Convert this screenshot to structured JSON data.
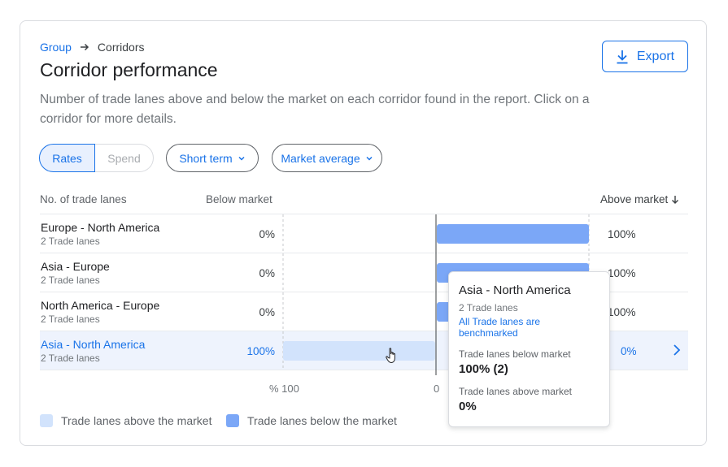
{
  "breadcrumb": {
    "group": "Group",
    "current": "Corridors"
  },
  "page": {
    "title": "Corridor performance",
    "description": "Number of trade lanes above and below the market on each corridor found in the report. Click on a corridor for more details."
  },
  "toolbar": {
    "export_label": "Export",
    "toggle_rates": "Rates",
    "toggle_spend": "Spend",
    "term_label": "Short term",
    "avg_label": "Market average"
  },
  "table": {
    "col_lanes": "No. of trade lanes",
    "col_below": "Below market",
    "col_above": "Above market",
    "rows": [
      {
        "name": "Europe - North America",
        "sub": "2 Trade lanes",
        "below": "0%",
        "above": "100%"
      },
      {
        "name": "Asia - Europe",
        "sub": "2 Trade lanes",
        "below": "0%",
        "above": "100%"
      },
      {
        "name": "North America - Europe",
        "sub": "2 Trade lanes",
        "below": "0%",
        "above": "100%"
      },
      {
        "name": "Asia - North America",
        "sub": "2 Trade lanes",
        "below": "100%",
        "above": "0%"
      }
    ]
  },
  "chart_data": {
    "type": "bar",
    "categories": [
      "Europe - North America",
      "Asia - Europe",
      "North America - Europe",
      "Asia - North America"
    ],
    "series": [
      {
        "name": "Trade lanes above the market",
        "values": [
          0,
          0,
          0,
          100
        ]
      },
      {
        "name": "Trade lanes below the market",
        "values": [
          100,
          100,
          100,
          0
        ]
      }
    ],
    "tick_labels": [
      "% 100",
      "0"
    ],
    "xlim": [
      -100,
      100
    ],
    "grid": true
  },
  "legend": {
    "above": "Trade lanes above the market",
    "below": "Trade lanes below the market"
  },
  "tooltip": {
    "title": "Asia - North America",
    "sub": "2 Trade lanes",
    "link": "All Trade lanes are benchmarked",
    "below_label": "Trade lanes below market",
    "below_value": "100% (2)",
    "above_label": "Trade lanes above market",
    "above_value": "0%"
  },
  "colors": {
    "accent": "#1a73e8",
    "bar_dark": "#7ba7f7",
    "bar_light": "#d2e3fc",
    "row_selected": "#eef3fd"
  },
  "icons": {
    "breadcrumb_separator": "arrow-right-icon",
    "export": "download-icon",
    "dropdown": "chevron-down-icon",
    "sort": "arrow-down-icon",
    "row_action": "chevron-right-icon",
    "pointer": "hand-cursor-icon"
  }
}
